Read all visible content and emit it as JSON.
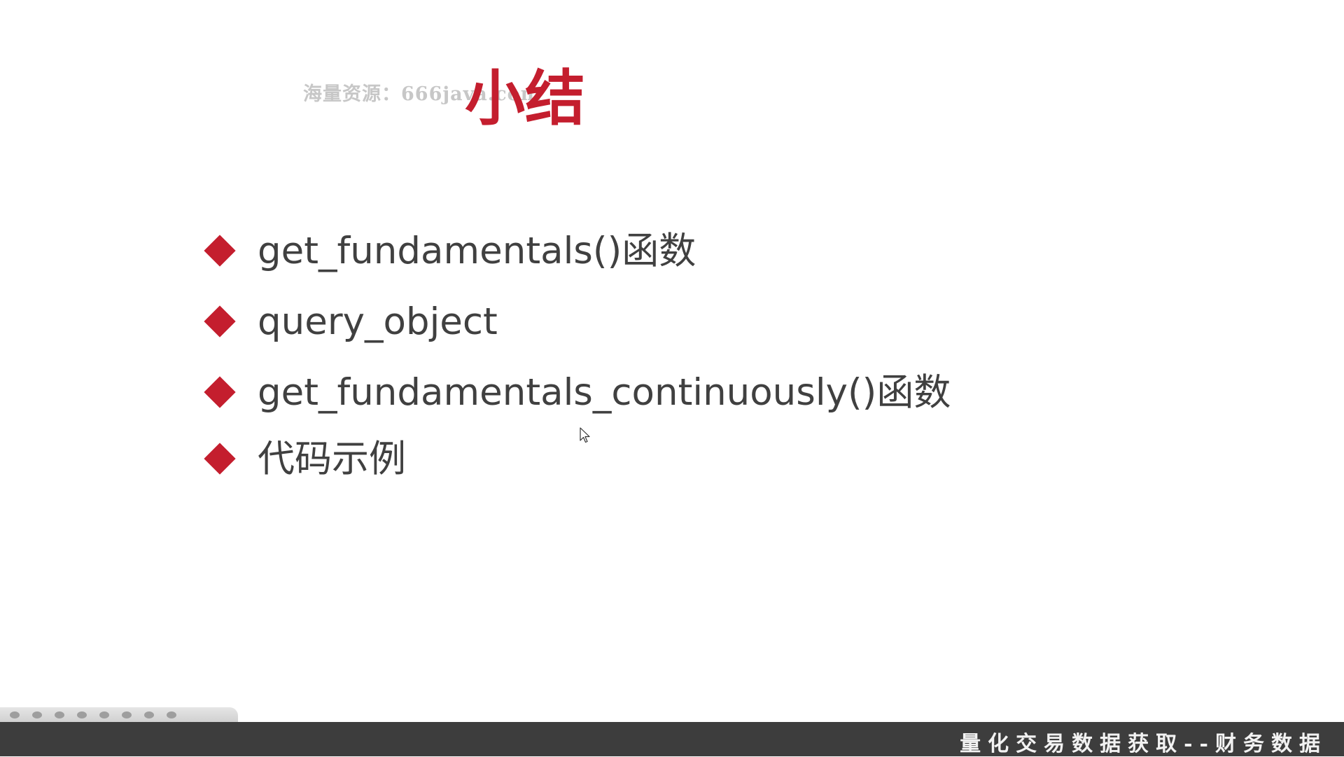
{
  "watermark": "海量资源：666java.com",
  "title": "小结",
  "bullets": [
    {
      "text": "get_fundamentals()函数"
    },
    {
      "text": "query_object"
    },
    {
      "text": "get_fundamentals_continuously()函数"
    },
    {
      "text": "代码示例"
    }
  ],
  "footer": {
    "caption": "量化交易数据获取--财务数据"
  },
  "colors": {
    "accent": "#c41e2e",
    "text": "#404040",
    "bottom_bar": "#3d3d3d",
    "watermark": "#c7c7c7"
  },
  "icons": {
    "bullet": "red-diamond",
    "pointer": "mouse-cursor-icon"
  }
}
